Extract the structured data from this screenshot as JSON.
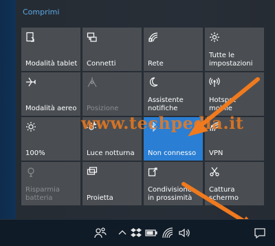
{
  "panel": {
    "collapse_label": "Comprimi"
  },
  "tiles": [
    {
      "label": "Modalità tablet",
      "icon": "tablet-mode-icon",
      "state": "normal"
    },
    {
      "label": "Connetti",
      "icon": "connect-icon",
      "state": "normal"
    },
    {
      "label": "Rete",
      "icon": "network-icon",
      "state": "normal"
    },
    {
      "label": "Tutte le impostazioni",
      "icon": "gear-icon",
      "state": "normal"
    },
    {
      "label": "Modalità aereo",
      "icon": "airplane-icon",
      "state": "normal"
    },
    {
      "label": "Posizione",
      "icon": "location-icon",
      "state": "disabled"
    },
    {
      "label": "Assistente notifiche",
      "icon": "moon-icon",
      "state": "normal"
    },
    {
      "label": "Hotspot mobile",
      "icon": "hotspot-icon",
      "state": "normal"
    },
    {
      "label": "100%",
      "icon": "brightness-icon",
      "state": "normal"
    },
    {
      "label": "Luce notturna",
      "icon": "night-light-icon",
      "state": "normal"
    },
    {
      "label": "Non connesso",
      "icon": "bluetooth-icon",
      "state": "active"
    },
    {
      "label": "VPN",
      "icon": "vpn-icon",
      "state": "normal"
    },
    {
      "label": "Risparmia batteria",
      "icon": "battery-saver-icon",
      "state": "disabled"
    },
    {
      "label": "Proietta",
      "icon": "project-icon",
      "state": "normal"
    },
    {
      "label": "Condivisione in prossimità",
      "icon": "nearby-sharing-icon",
      "state": "normal"
    },
    {
      "label": "Cattura schermo",
      "icon": "screen-snip-icon",
      "state": "normal"
    }
  ],
  "watermark": "www.techpedia.it",
  "colors": {
    "accent": "#2a7ed3",
    "tile": "#4a4e53",
    "panel": "#282c32",
    "arrow": "#f07a1e"
  }
}
